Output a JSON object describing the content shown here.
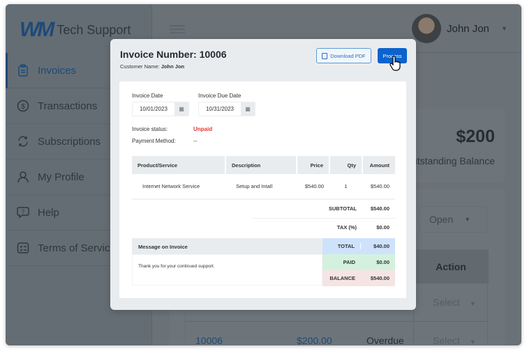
{
  "brand": {
    "logo": "WM",
    "name": "Tech Support"
  },
  "sidebar": {
    "items": [
      {
        "label": "Invoices",
        "icon": "clipboard-icon",
        "active": true
      },
      {
        "label": "Transactions",
        "icon": "dollar-circle-icon"
      },
      {
        "label": "Subscriptions",
        "icon": "refresh-icon"
      },
      {
        "label": "My Profile",
        "icon": "user-icon"
      },
      {
        "label": "Help",
        "icon": "help-bubble-icon"
      },
      {
        "label": "Terms of Service",
        "icon": "checklist-icon"
      }
    ]
  },
  "header": {
    "user_name": "John Jon"
  },
  "balance": {
    "amount": "$200",
    "label": "Outstanding Balance"
  },
  "filter": {
    "value": "Open"
  },
  "table": {
    "action_header": "Action",
    "rows": [
      {
        "action": "Select"
      },
      {
        "invoice": "10006",
        "amount": "$200.00",
        "status": "Overdue",
        "action": "Select"
      }
    ]
  },
  "modal": {
    "title": "Invoice Number: 10006",
    "customer_label": "Customer Name:",
    "customer_name": "John Jon",
    "download_label": "Download PDF",
    "process_label": "Process",
    "invoice_date_label": "Invoice Date",
    "invoice_date": "10/01/2023",
    "due_date_label": "Invoice Due Date",
    "due_date": "10/31/2023",
    "status_label": "Invoice status:",
    "status": "Unpaid",
    "payment_label": "Payment Method:",
    "payment": "--",
    "columns": [
      "Product/Service",
      "Description",
      "Price",
      "Qty",
      "Amount"
    ],
    "items": [
      {
        "product": "Internet Network Service",
        "description": "Setup and Intall",
        "price": "$540.00",
        "qty": "1",
        "amount": "$540.00"
      }
    ],
    "subtotal_label": "SUBTOTAL",
    "subtotal": "$540.00",
    "tax_label": "TAX (%)",
    "tax": "$0.00",
    "message_label": "Message on Invoice",
    "message": "Thank you for your continued support.",
    "total_label": "TOTAL",
    "total": "$40.00",
    "paid_label": "PAID",
    "paid": "$0.00",
    "balance_label": "BALANCE",
    "balance": "$540.00",
    "colors": {
      "unpaid": "#e53935",
      "total": "#cfe2fb",
      "paid": "#d4f1de",
      "balance": "#f6e4e4",
      "primary": "#0b63ce"
    }
  }
}
